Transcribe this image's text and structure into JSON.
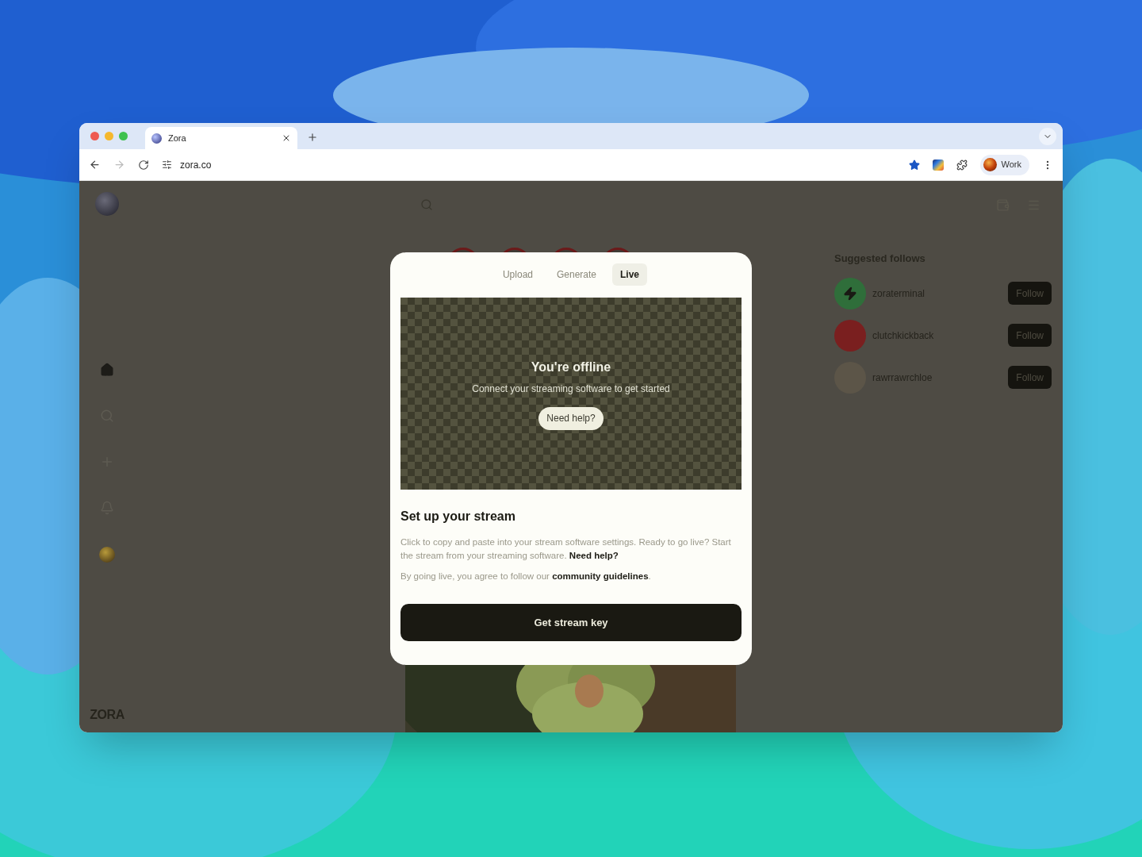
{
  "browser": {
    "tabs": [
      {
        "title": "Zora",
        "selected": true
      }
    ],
    "url": "zora.co",
    "profile": "Work",
    "bookmarked": true
  },
  "sidebar": {
    "items": [
      {
        "selected": true
      },
      {
        "selected": false
      },
      {
        "selected": false
      },
      {
        "selected": false
      }
    ],
    "wordmark": "ZORA"
  },
  "suggested_follows": {
    "title": "Suggested follows",
    "users": [
      {
        "name": "zoraterminal",
        "button": "Follow",
        "color": "#2f6e3a"
      },
      {
        "name": "clutchkickback",
        "button": "Follow",
        "color": "#7a1f1f"
      },
      {
        "name": "rawrrawrchloe",
        "button": "Follow",
        "color": "#5c5548"
      }
    ]
  },
  "modal": {
    "tabs": [
      {
        "label": "Upload",
        "selected": false
      },
      {
        "label": "Generate",
        "selected": false
      },
      {
        "label": "Live",
        "selected": true
      }
    ],
    "preview": {
      "title": "You're offline",
      "subtitle": "Connect your streaming software to get started",
      "button": "Need help?"
    },
    "heading": "Set up your stream",
    "paragraphs": [
      {
        "text": "Click to copy and paste into your stream software settings. Ready to go live? Start the stream from your streaming software.",
        "link": "Need help?"
      },
      {
        "text": "By going live, you agree to follow our",
        "link": "community guidelines",
        "after": "."
      }
    ],
    "primary_button": "Get stream key"
  }
}
